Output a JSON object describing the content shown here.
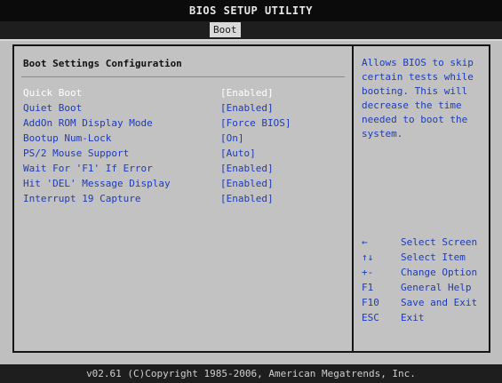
{
  "header": {
    "title": "BIOS SETUP UTILITY",
    "active_tab": "Boot"
  },
  "section": {
    "title": "Boot Settings Configuration"
  },
  "settings": [
    {
      "label": "Quick Boot",
      "value": "[Enabled]",
      "selected": true
    },
    {
      "label": "Quiet Boot",
      "value": "[Enabled]",
      "selected": false
    },
    {
      "label": "AddOn ROM Display Mode",
      "value": "[Force BIOS]",
      "selected": false
    },
    {
      "label": "Bootup Num-Lock",
      "value": "[On]",
      "selected": false
    },
    {
      "label": "PS/2 Mouse Support",
      "value": "[Auto]",
      "selected": false
    },
    {
      "label": "Wait For 'F1' If Error",
      "value": "[Enabled]",
      "selected": false
    },
    {
      "label": "Hit 'DEL' Message Display",
      "value": "[Enabled]",
      "selected": false
    },
    {
      "label": "Interrupt 19 Capture",
      "value": "[Enabled]",
      "selected": false
    }
  ],
  "help": {
    "lines": [
      "Allows BIOS to skip",
      "certain tests while",
      "booting. This will",
      "decrease the time",
      "needed to boot the",
      "system."
    ]
  },
  "keys": [
    {
      "key": "←",
      "desc": "Select Screen"
    },
    {
      "key": "↑↓",
      "desc": "Select Item"
    },
    {
      "key": "+-",
      "desc": "Change Option"
    },
    {
      "key": "F1",
      "desc": "General Help"
    },
    {
      "key": "F10",
      "desc": "Save and Exit"
    },
    {
      "key": "ESC",
      "desc": "Exit"
    }
  ],
  "footer": {
    "text": "v02.61 (C)Copyright 1985-2006, American Megatrends, Inc."
  },
  "colors": {
    "text_blue": "#1d3bb8",
    "selected": "#ffffff",
    "panel": "#c2c2c2",
    "bar": "#1e1e1e"
  }
}
